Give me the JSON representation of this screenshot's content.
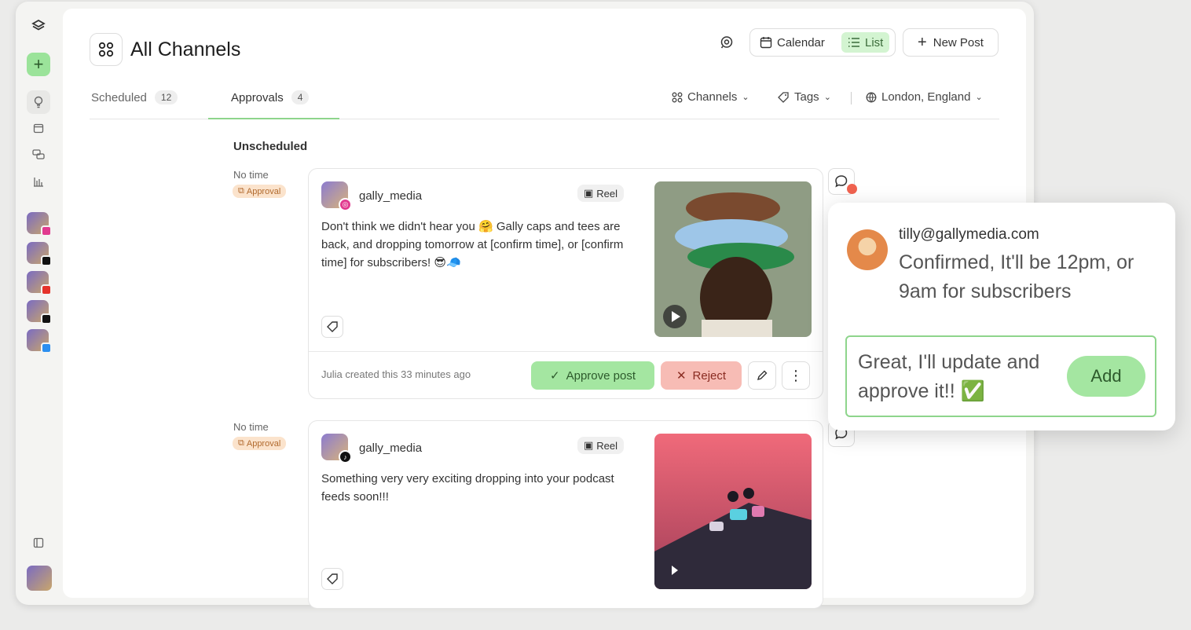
{
  "page": {
    "title": "All Channels"
  },
  "header": {
    "view_calendar": "Calendar",
    "view_list": "List",
    "new_post": "New Post"
  },
  "tabs": [
    {
      "label": "Scheduled",
      "count": "12"
    },
    {
      "label": "Approvals",
      "count": "4"
    }
  ],
  "filters": {
    "channels": "Channels",
    "tags": "Tags",
    "location": "London, England"
  },
  "section": "Unscheduled",
  "posts": [
    {
      "time": "No time",
      "badge": "Approval",
      "network": "instagram",
      "username": "gally_media",
      "type": "Reel",
      "text": "Don't think we didn't hear you 🤗 Gally caps and tees are back, and dropping tomorrow at [confirm time], or [confirm time] for subscribers! 😎🧢",
      "created": "Julia created this 33 minutes ago",
      "approve": "Approve post",
      "reject": "Reject"
    },
    {
      "time": "No time",
      "badge": "Approval",
      "network": "tiktok",
      "username": "gally_media",
      "type": "Reel",
      "text": "Something very very exciting dropping into your podcast feeds soon!!!"
    }
  ],
  "comment": {
    "email": "tilly@gallymedia.com",
    "message": "Confirmed, It'll be 12pm, or 9am for subscribers",
    "reply": "Great, I'll update and approve it!! ✅",
    "add": "Add"
  },
  "colors": {
    "accent": "#a4e6a1",
    "reject": "#f7bcb5",
    "notification": "#f0624f",
    "badge": "#fbe3cc"
  }
}
